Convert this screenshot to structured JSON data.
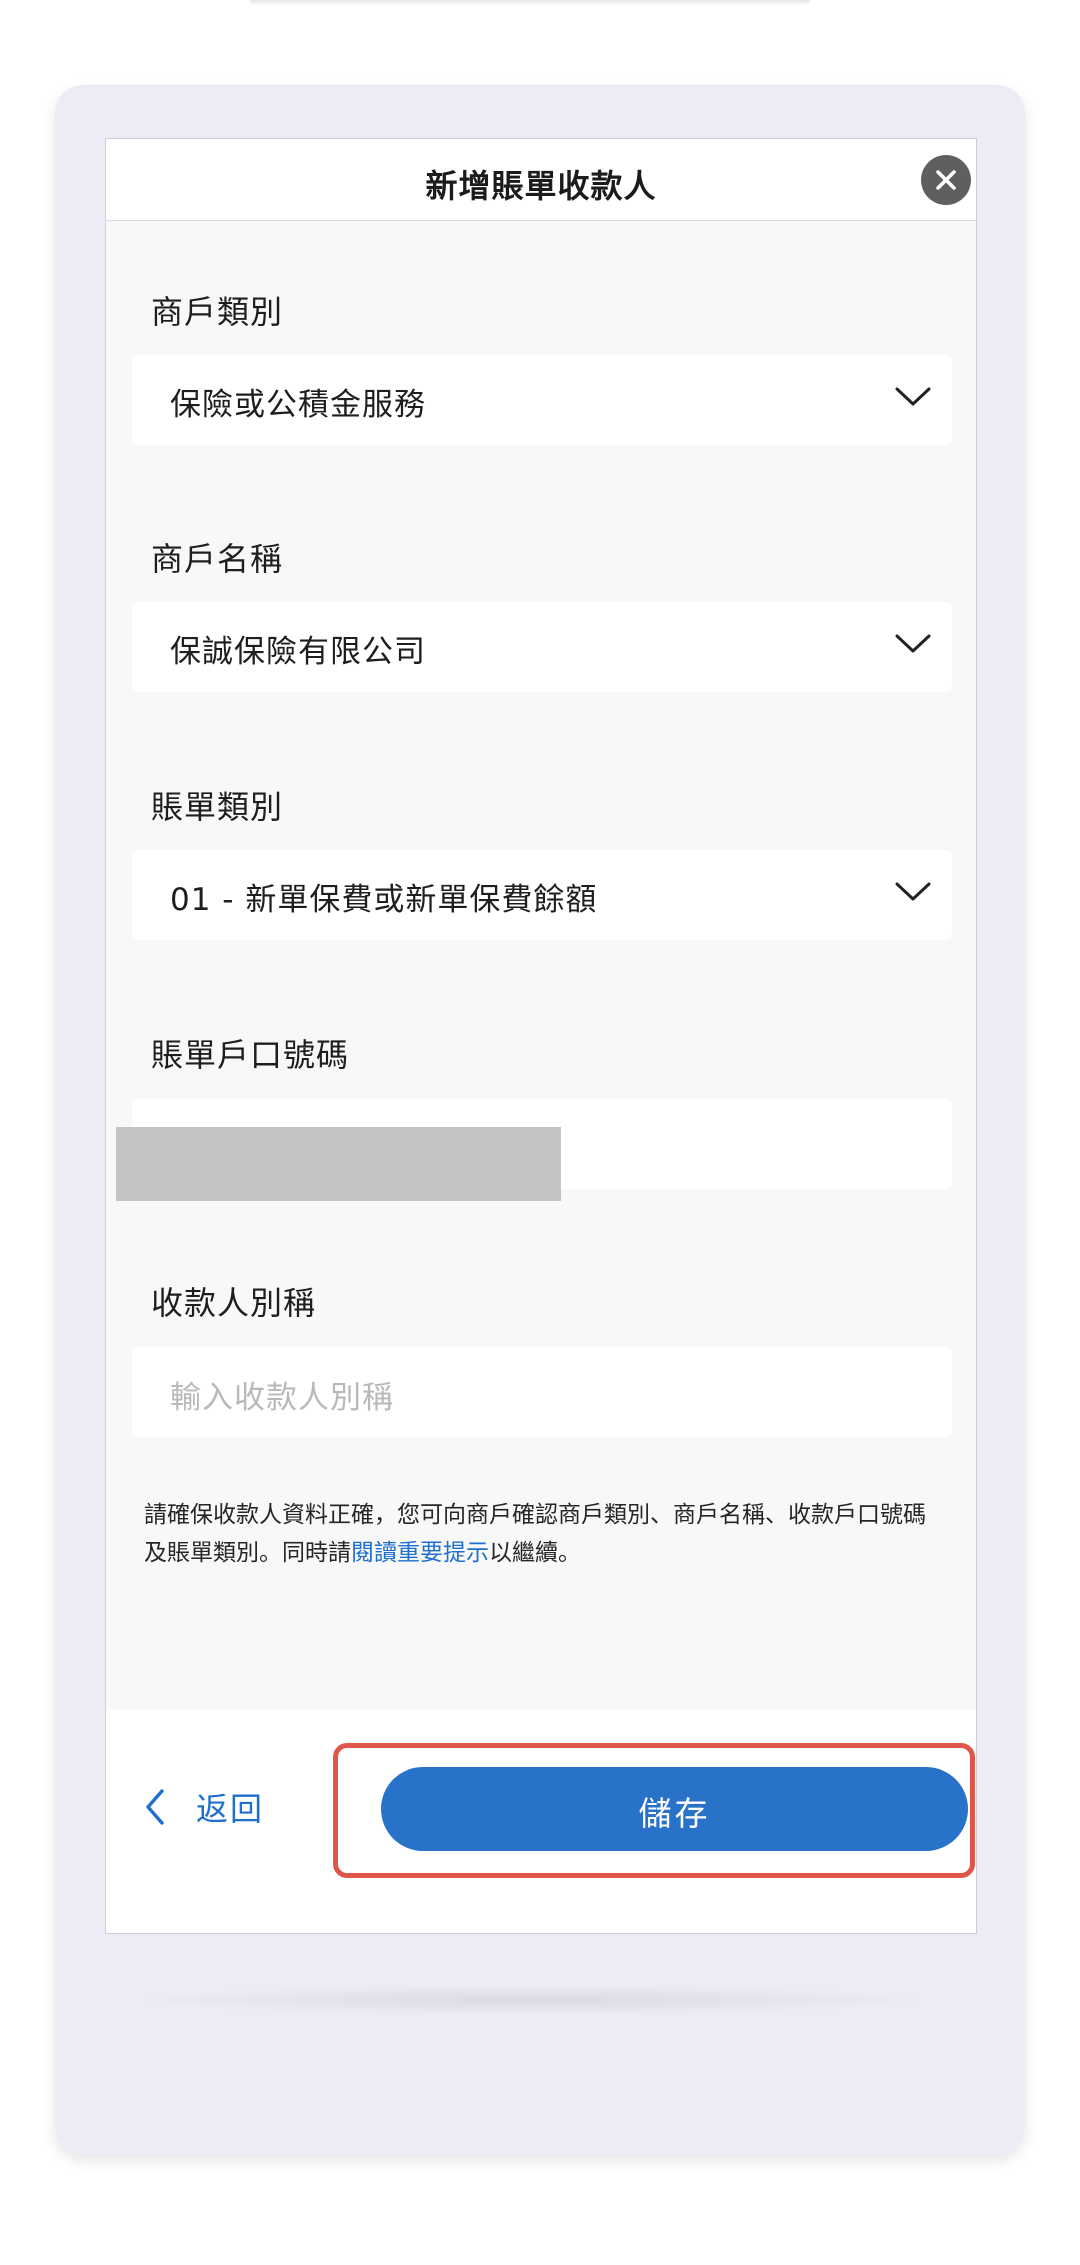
{
  "header": {
    "title": "新增賬單收款人"
  },
  "form": {
    "merchant_type": {
      "label": "商戶類別",
      "value": "保險或公積金服務"
    },
    "merchant_name": {
      "label": "商戶名稱",
      "value": "保誠保險有限公司"
    },
    "bill_type": {
      "label": "賬單類別",
      "value": "01 - 新單保費或新單保費餘額"
    },
    "account_number": {
      "label": "賬單戶口號碼"
    },
    "nickname": {
      "label": "收款人別稱",
      "placeholder": "輸入收款人別稱"
    }
  },
  "notice": {
    "text_before": "請確保收款人資料正確，您可向商戶確認商戶類別、商戶名稱、收款戶口號碼及賬單類別。同時請",
    "link": "閱讀重要提示",
    "text_after": "以繼續。"
  },
  "footer": {
    "back_label": "返回",
    "save_label": "儲存"
  },
  "colors": {
    "accent": "#2873c9",
    "highlight": "#e0564a",
    "frame": "#ececf7"
  },
  "icons": {
    "close": "close-icon",
    "dropdown": "chevron-down-icon",
    "back": "chevron-left-icon"
  }
}
